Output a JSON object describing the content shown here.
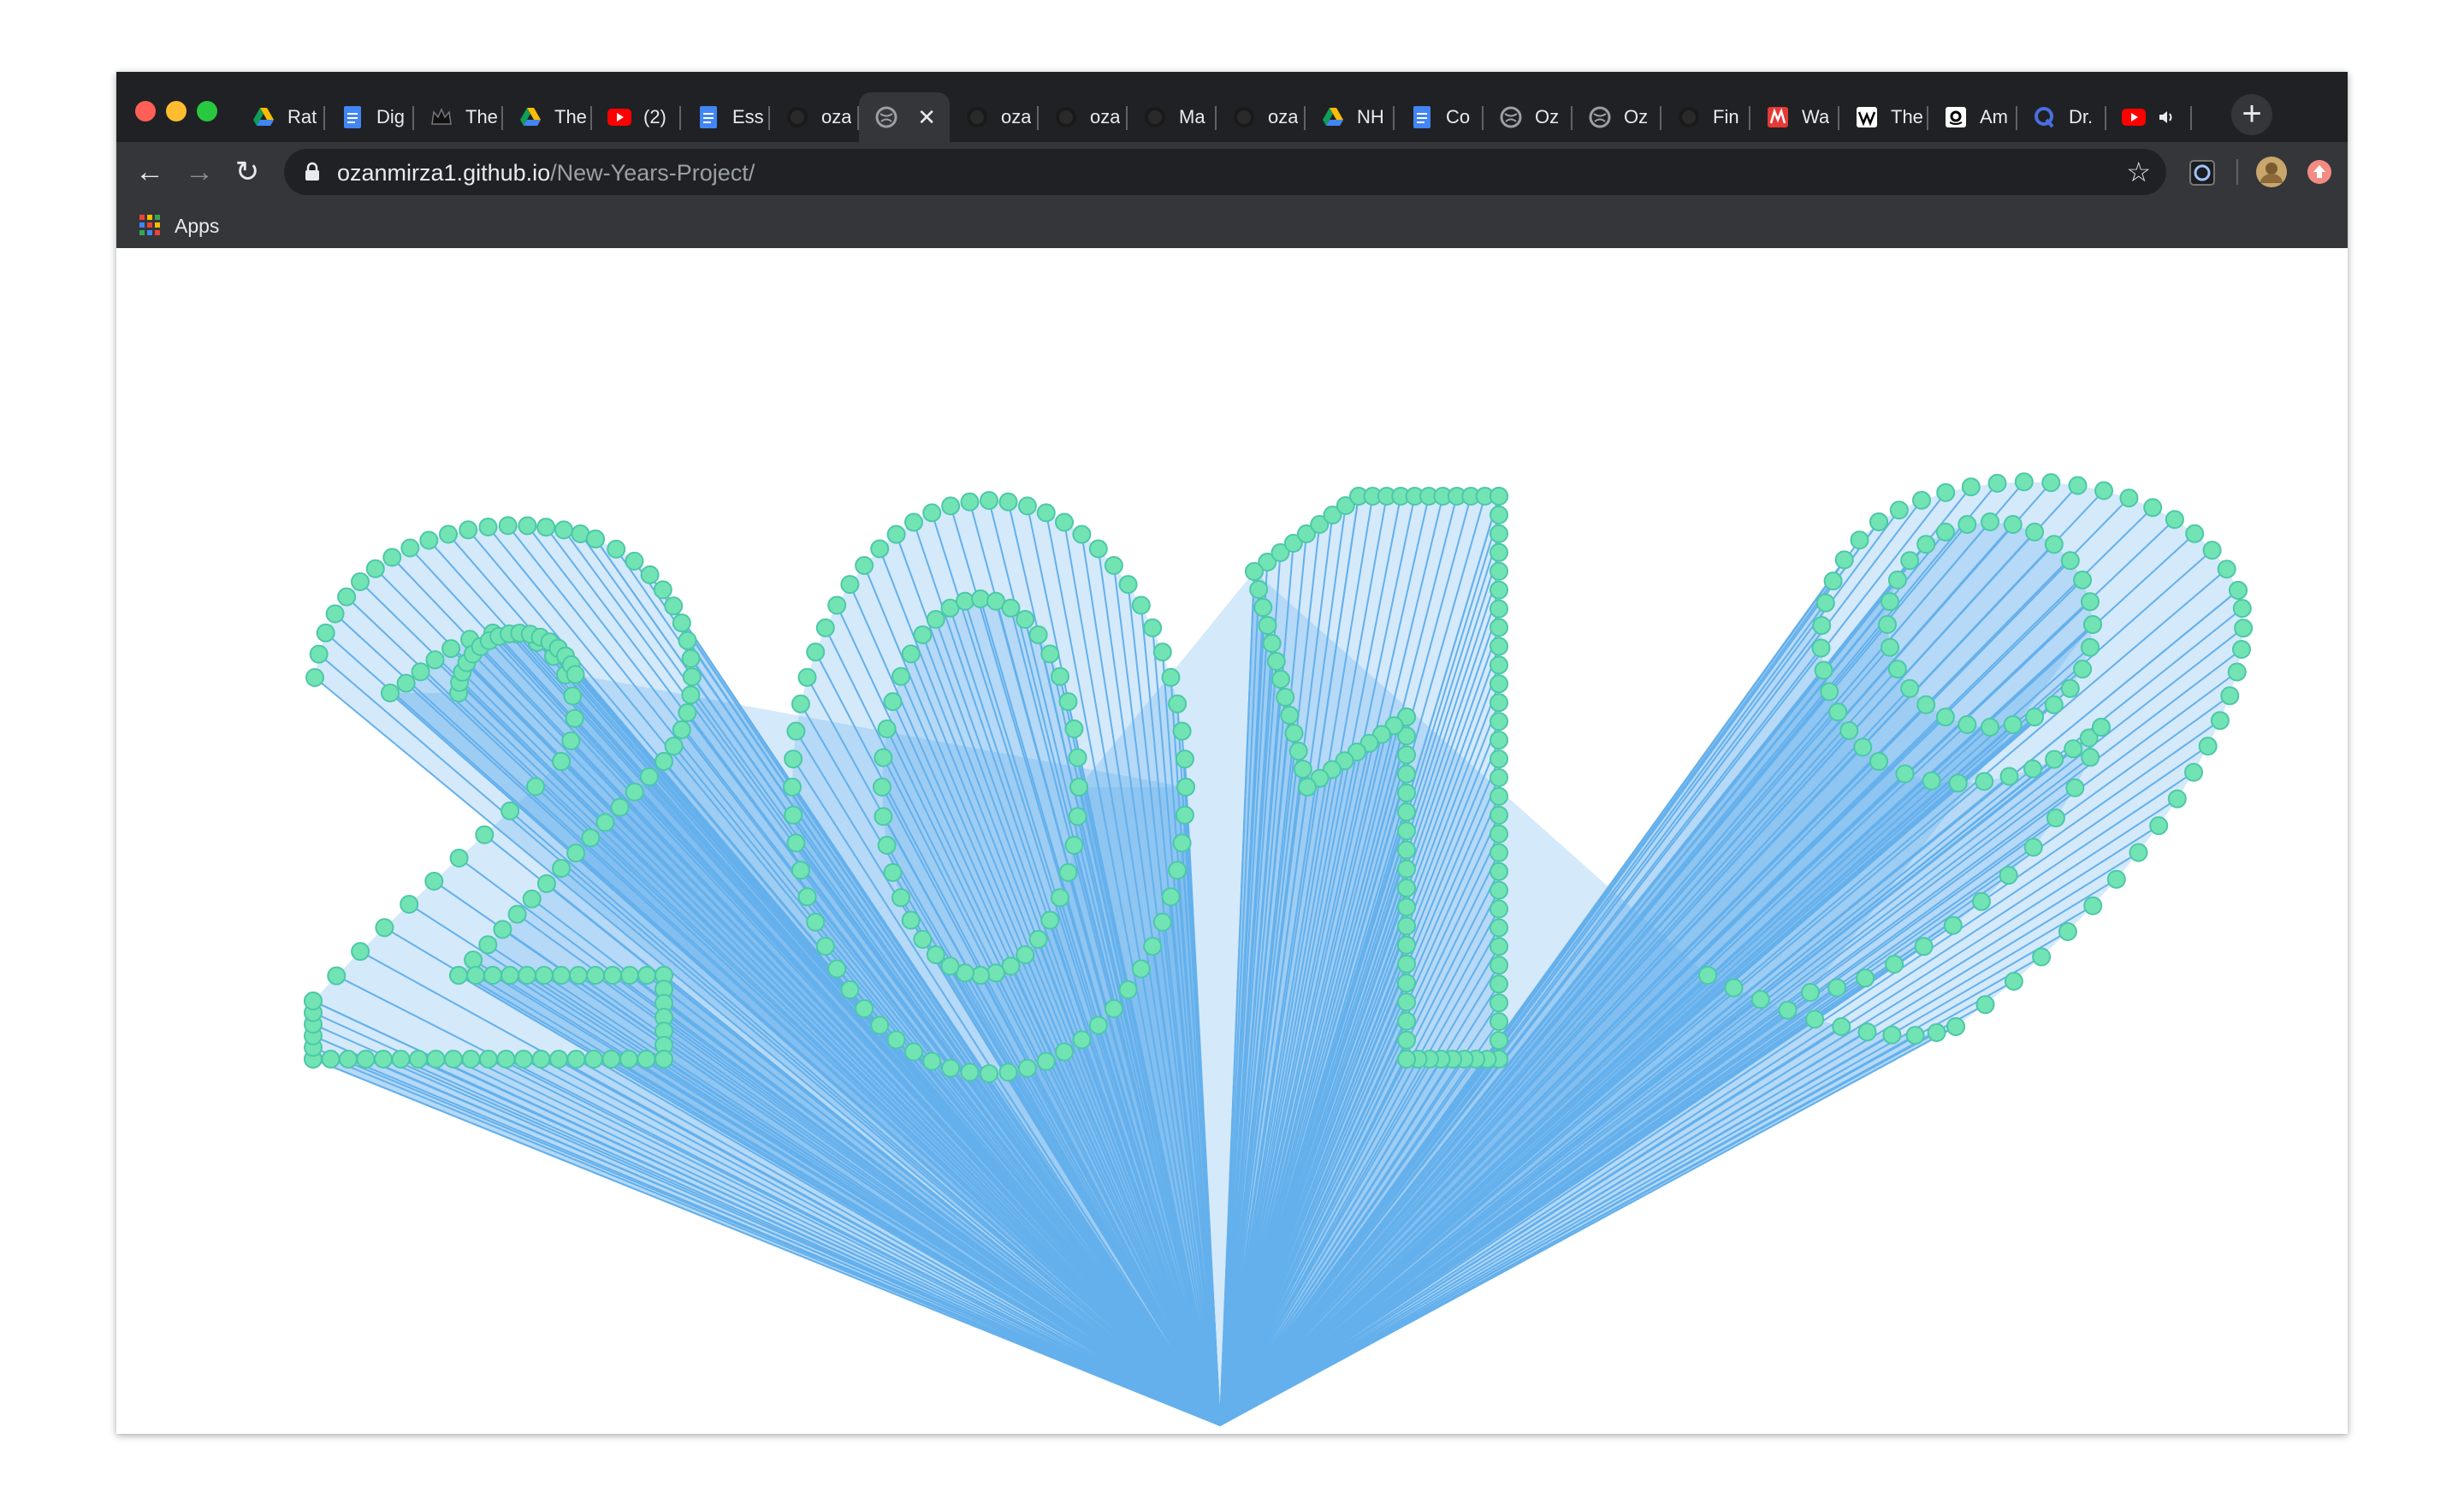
{
  "window": {
    "traffic_light_colors": [
      "#ff5f57",
      "#febc2e",
      "#28c840"
    ]
  },
  "tabs": [
    {
      "title": "Rat",
      "icon": "google-drive-icon"
    },
    {
      "title": "Dig",
      "icon": "google-docs-icon"
    },
    {
      "title": "The",
      "icon": "crown-icon"
    },
    {
      "title": "The",
      "icon": "google-drive-icon"
    },
    {
      "title": "(2)",
      "icon": "youtube-icon"
    },
    {
      "title": "Ess",
      "icon": "google-docs-icon"
    },
    {
      "title": "oza",
      "icon": "github-icon"
    },
    {
      "title": "",
      "icon": "globe-icon",
      "active": true,
      "close": "✕"
    },
    {
      "title": "oza",
      "icon": "github-icon"
    },
    {
      "title": "oza",
      "icon": "github-icon"
    },
    {
      "title": "Ma",
      "icon": "github-icon"
    },
    {
      "title": "oza",
      "icon": "github-icon"
    },
    {
      "title": "NH",
      "icon": "google-drive-icon"
    },
    {
      "title": "Co",
      "icon": "google-docs-icon"
    },
    {
      "title": "Oz",
      "icon": "globe-icon"
    },
    {
      "title": "Oz",
      "icon": "globe-icon"
    },
    {
      "title": "Fin",
      "icon": "github-icon"
    },
    {
      "title": "Wa",
      "icon": "red-logo-icon"
    },
    {
      "title": "The",
      "icon": "wikipedia-icon"
    },
    {
      "title": "Am",
      "icon": "amazon-icon"
    },
    {
      "title": "Dr.",
      "icon": "quora-icon"
    },
    {
      "title": "",
      "icon": "youtube-icon",
      "audio": true
    }
  ],
  "new_tab": "+",
  "toolbar": {
    "back": "←",
    "forward": "→",
    "reload": "↻",
    "url_host": "ozanmirza1.github.io",
    "url_path": "/New-Years-Project/",
    "star": "☆"
  },
  "bookmarks": {
    "apps_label": "Apps"
  },
  "artwork": {
    "line_color": "#64b0ec",
    "dot_color": "#72e4b4",
    "dot_stroke": "#4cc8a8"
  }
}
